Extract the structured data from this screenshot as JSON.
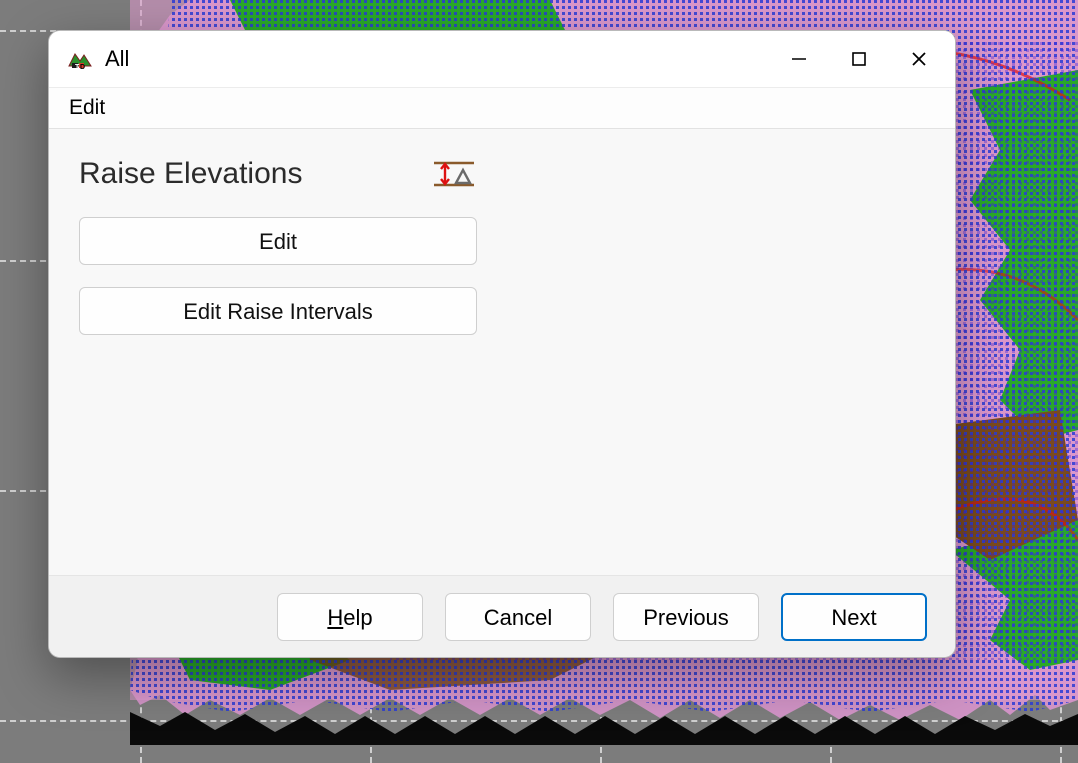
{
  "window": {
    "title": "All"
  },
  "menu": {
    "edit": "Edit"
  },
  "section": {
    "title": "Raise Elevations"
  },
  "buttons": {
    "edit": "Edit",
    "edit_intervals": "Edit Raise Intervals"
  },
  "footer": {
    "help_u": "H",
    "help_rest": "elp",
    "cancel": "Cancel",
    "previous": "Previous",
    "next": "Next"
  }
}
